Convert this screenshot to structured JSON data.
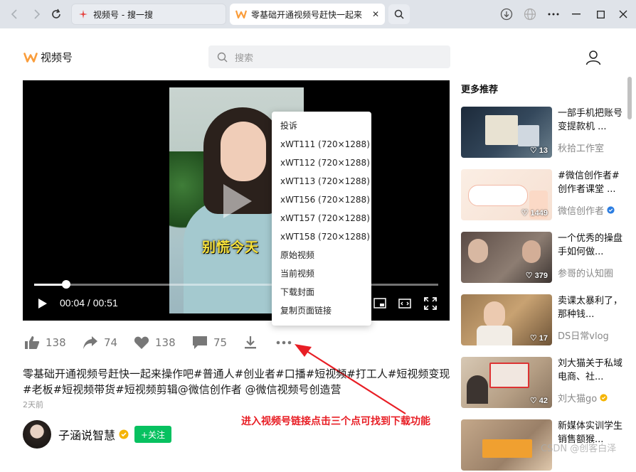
{
  "browser": {
    "tabs": [
      {
        "label": "视频号 - 搜一搜",
        "active": false
      },
      {
        "label": "零基础开通视频号赶快一起来",
        "active": true
      }
    ],
    "close_glyph": "✕"
  },
  "header": {
    "logo_text": "视频号",
    "search_placeholder": "搜索",
    "accent_color": "#fa9d3b"
  },
  "player": {
    "caption": "别慌今天",
    "current_time": "00:04 / 00:51",
    "progress": 0.08
  },
  "context_menu": {
    "items": [
      "投诉",
      "xWT111 (720×1288)",
      "xWT112 (720×1288)",
      "xWT113 (720×1288)",
      "xWT156 (720×1288)",
      "xWT157 (720×1288)",
      "xWT158 (720×1288)",
      "原始视频",
      "当前视频",
      "下载封面",
      "复制页面链接"
    ]
  },
  "actions": {
    "likes": "138",
    "shares": "74",
    "hearts": "138",
    "comments": "75"
  },
  "video": {
    "description": "零基础开通视频号赶快一起来操作吧#普通人#创业者#口播#短视频#打工人#短视频变现#老板#短视频带货#短视频剪辑@微信创作者 @微信视频号创造营",
    "posted": "2天前",
    "author": "子涵说智慧",
    "follow_label": "+关注"
  },
  "annotation": {
    "text": "进入视频号链接点击三个点可找到下载功能",
    "color": "#e81e25"
  },
  "recommendations": {
    "title": "更多推荐",
    "items": [
      {
        "title": "一部手机把账号变提款机 ...",
        "author": "秋拾工作室",
        "likes": "13",
        "verified": false
      },
      {
        "title": "#微信创作者#创作者课堂 ...",
        "author": "微信创作者",
        "likes": "1449",
        "verified": true
      },
      {
        "title": "一个优秀的操盘手如何做...",
        "author": "参哥的认知圈",
        "likes": "379",
        "verified": false
      },
      {
        "title": "卖课太暴利了，那种钱...",
        "author": "DS日常vlog",
        "likes": "17",
        "verified": false
      },
      {
        "title": "刘大猫关于私域电商、社...",
        "author": "刘大猫go",
        "likes": "42",
        "verified": true
      },
      {
        "title": "新媒体实训学生销售额猴...",
        "author": "",
        "likes": "",
        "verified": false
      }
    ]
  },
  "watermark": "CSDN @创客白泽"
}
